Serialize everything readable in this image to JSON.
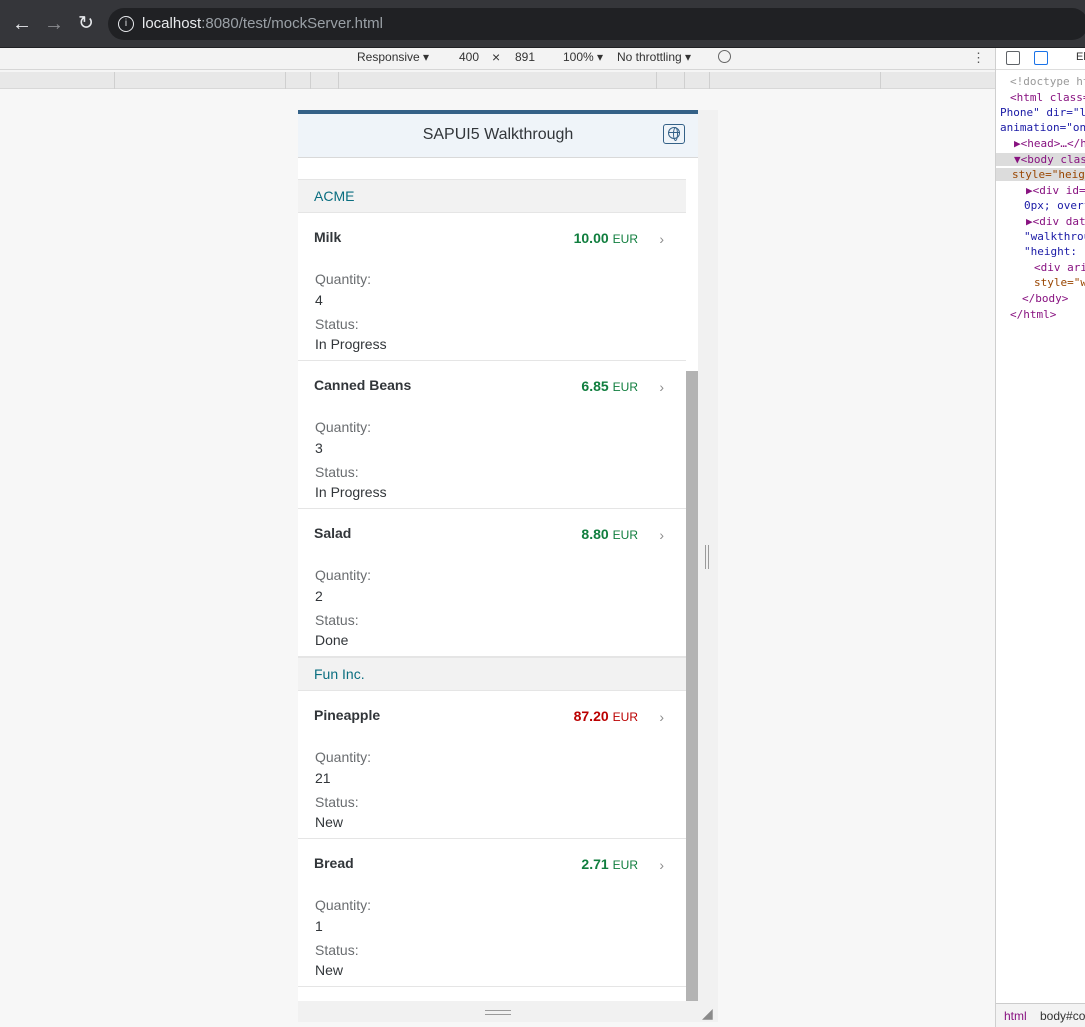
{
  "browser": {
    "url_host": "localhost",
    "url_rest": ":8080/test/mockServer.html"
  },
  "device_toolbar": {
    "device": "Responsive ▾",
    "width": "400",
    "times": "×",
    "height": "891",
    "zoom": "100% ▾",
    "throttling": "No throttling ▾"
  },
  "devtools": {
    "tab": "El",
    "lines": [
      "<!doctype ht",
      "<html class=",
      "Phone\" dir=\"l",
      "animation=\"on",
      "▶<head>…</h",
      "▼<body clas",
      "style=\"heig",
      "▶<div id=",
      "0px; overf",
      "▶<div dat",
      "\"walkthrou",
      "\"height: ",
      "<div ari",
      "style=\"w",
      "</body>",
      "</html>"
    ],
    "footer_html": "html",
    "footer_body": "body#co"
  },
  "app": {
    "title": "SAPUI5 Walkthrough",
    "quantity_label": "Quantity:",
    "status_label": "Status:",
    "groups": [
      {
        "name": "ACME",
        "items": [
          {
            "name": "Milk",
            "price": "10.00",
            "currency": "EUR",
            "quantity": "4",
            "status": "In Progress",
            "state": "pos"
          },
          {
            "name": "Canned Beans",
            "price": "6.85",
            "currency": "EUR",
            "quantity": "3",
            "status": "In Progress",
            "state": "pos"
          },
          {
            "name": "Salad",
            "price": "8.80",
            "currency": "EUR",
            "quantity": "2",
            "status": "Done",
            "state": "pos"
          }
        ]
      },
      {
        "name": "Fun Inc.",
        "items": [
          {
            "name": "Pineapple",
            "price": "87.20",
            "currency": "EUR",
            "quantity": "21",
            "status": "New",
            "state": "neg"
          },
          {
            "name": "Bread",
            "price": "2.71",
            "currency": "EUR",
            "quantity": "1",
            "status": "New",
            "state": "pos"
          }
        ]
      }
    ]
  }
}
